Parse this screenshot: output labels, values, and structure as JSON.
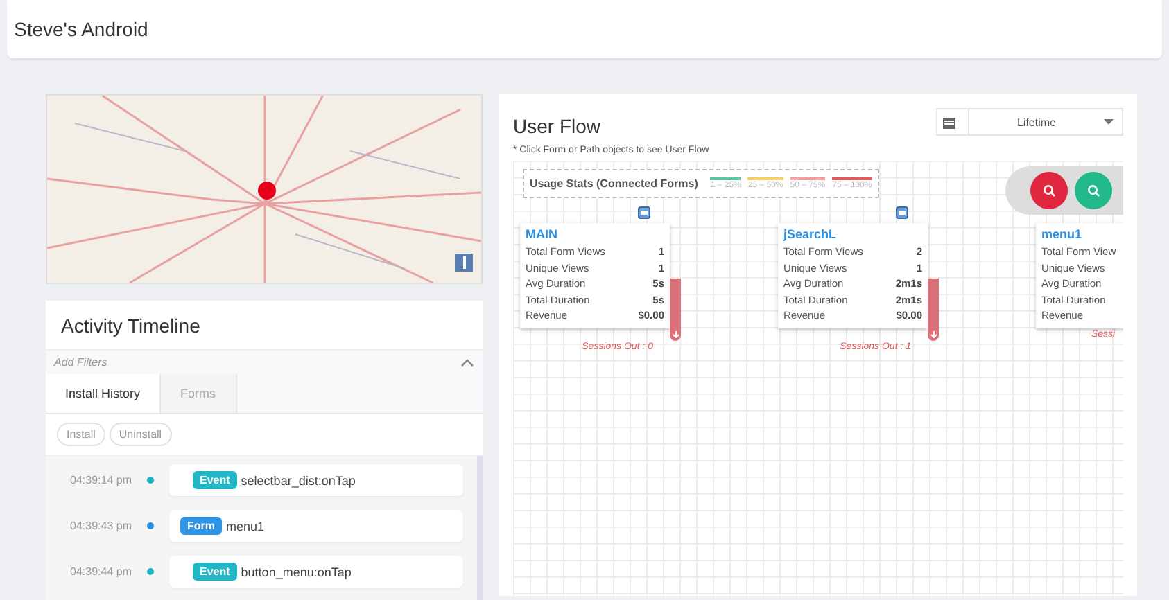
{
  "window": {
    "title": "Steve's Android"
  },
  "activity": {
    "title": "Activity Timeline",
    "filters_label": "Add Filters",
    "tabs": [
      {
        "label": "Install History",
        "selected": true
      },
      {
        "label": "Forms",
        "selected": false
      }
    ],
    "chips": [
      "Install",
      "Uninstall"
    ],
    "items": [
      {
        "time": "04:39:14 pm",
        "kind": "event",
        "tag": "Event",
        "text": "selectbar_dist:onTap"
      },
      {
        "time": "04:39:43 pm",
        "kind": "form",
        "tag": "Form",
        "text": "menu1"
      },
      {
        "time": "04:39:44 pm",
        "kind": "event",
        "tag": "Event",
        "text": "button_menu:onTap"
      }
    ]
  },
  "user_flow": {
    "title": "User Flow",
    "hint": "* Click Form or Path objects to see User Flow",
    "period": "Lifetime",
    "legend": {
      "title": "Usage Stats (Connected Forms)",
      "items": [
        {
          "label": "1 – 25%",
          "color": "#5cc8a0"
        },
        {
          "label": "25 – 50%",
          "color": "#f0cf6a"
        },
        {
          "label": "50 – 75%",
          "color": "#f0a0a0"
        },
        {
          "label": "75 – 100%",
          "color": "#e05a5a"
        }
      ]
    },
    "forms": [
      {
        "name": "MAIN",
        "rows": [
          {
            "label": "Total Form Views",
            "value": "1"
          },
          {
            "label": "Unique Views",
            "value": "1"
          },
          {
            "label": "Avg Duration",
            "value": "5s"
          },
          {
            "label": "Total Duration",
            "value": "5s"
          },
          {
            "label": "Revenue",
            "value": "$0.00"
          }
        ],
        "sessions_out": "Sessions Out : 0"
      },
      {
        "name": "jSearchL",
        "rows": [
          {
            "label": "Total Form Views",
            "value": "2"
          },
          {
            "label": "Unique Views",
            "value": "1"
          },
          {
            "label": "Avg Duration",
            "value": "2m1s"
          },
          {
            "label": "Total Duration",
            "value": "2m1s"
          },
          {
            "label": "Revenue",
            "value": "$0.00"
          }
        ],
        "sessions_out": "Sessions Out : 1"
      },
      {
        "name": "menu1",
        "rows": [
          {
            "label": "Total Form View"
          },
          {
            "label": "Unique Views"
          },
          {
            "label": "Avg Duration"
          },
          {
            "label": "Total Duration"
          },
          {
            "label": "Revenue"
          }
        ],
        "sessions_out": "Sessi"
      }
    ]
  }
}
